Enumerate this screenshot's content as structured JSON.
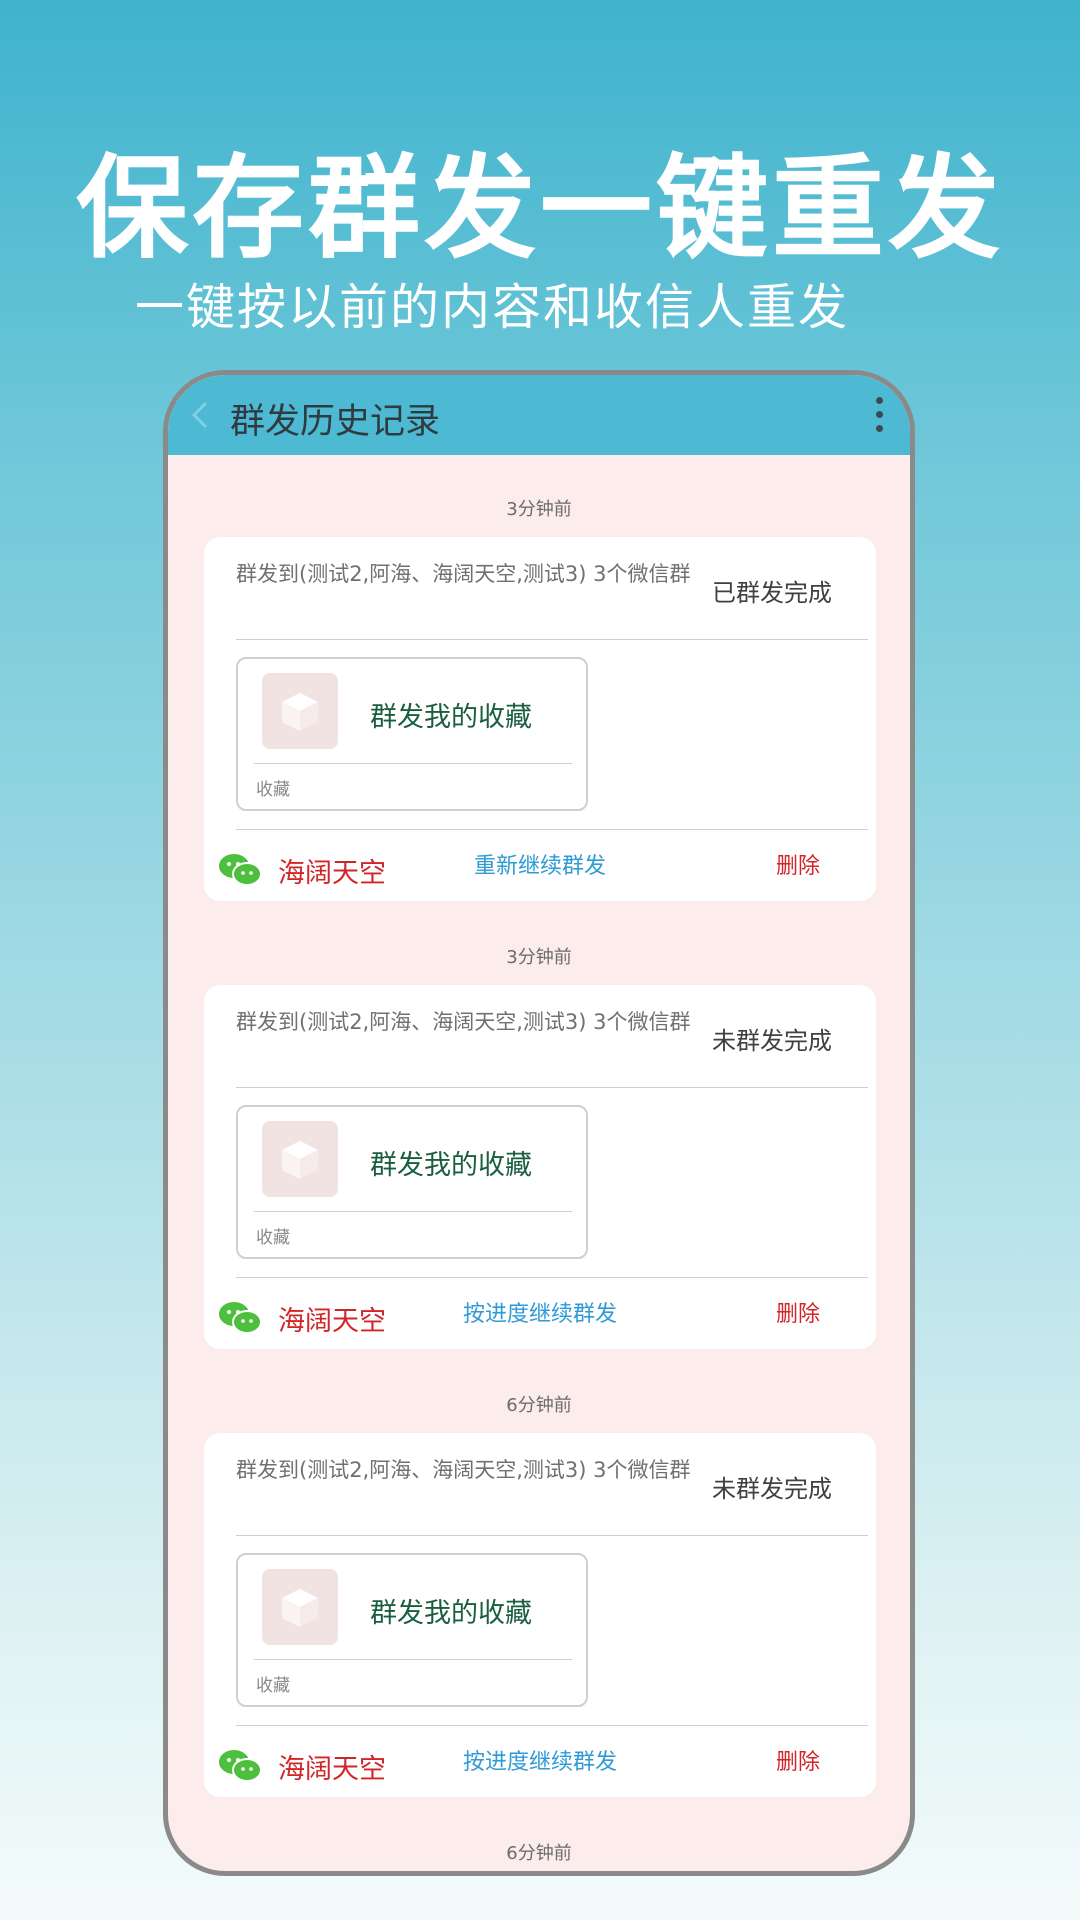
{
  "promo": {
    "title": "保存群发一键重发",
    "subtitle": "一键按以前的内容和收信人重发"
  },
  "app_bar": {
    "title": "群发历史记录",
    "back_icon": "chevron-left-icon",
    "more_icon": "more-vertical-icon"
  },
  "history": [
    {
      "time": "3分钟前",
      "description": "群发到(测试2,阿海、海阔天空,测试3) 3个微信群",
      "status": "已群发完成",
      "favorite": {
        "title": "群发我的收藏",
        "label": "收藏"
      },
      "contact": "海阔天空",
      "action": "重新继续群发",
      "delete": "删除"
    },
    {
      "time": "3分钟前",
      "description": "群发到(测试2,阿海、海阔天空,测试3) 3个微信群",
      "status": "未群发完成",
      "favorite": {
        "title": "群发我的收藏",
        "label": "收藏"
      },
      "contact": "海阔天空",
      "action": "按进度继续群发",
      "delete": "删除"
    },
    {
      "time": "6分钟前",
      "description": "群发到(测试2,阿海、海阔天空,测试3) 3个微信群",
      "status": "未群发完成",
      "favorite": {
        "title": "群发我的收藏",
        "label": "收藏"
      },
      "contact": "海阔天空",
      "action": "按进度继续群发",
      "delete": "删除"
    }
  ],
  "next_time": "6分钟前",
  "colors": {
    "accent": "#4db9d3",
    "danger": "#d0262a",
    "link": "#2e9bd6",
    "wechat_green": "#4cbf3c"
  }
}
